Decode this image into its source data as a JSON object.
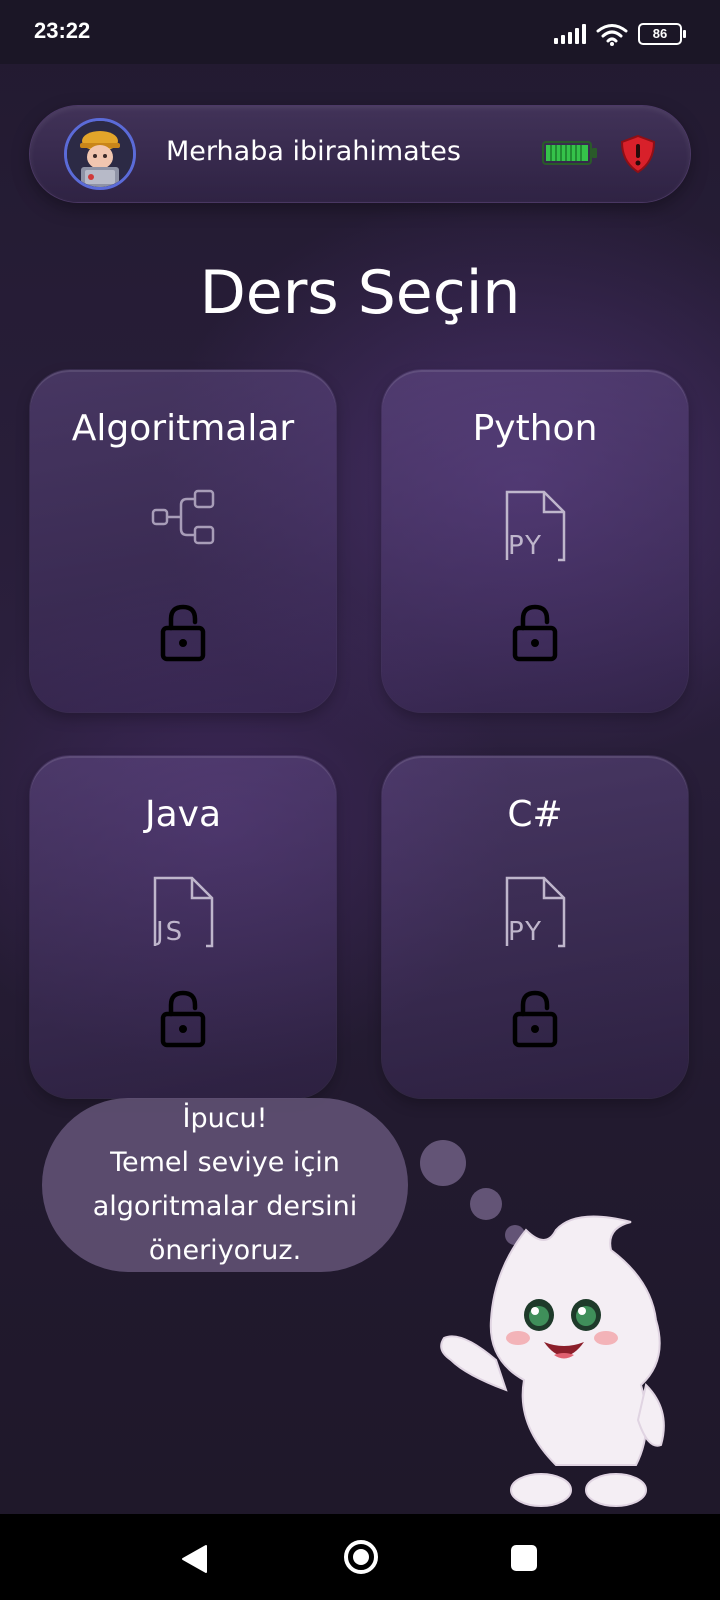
{
  "status_bar": {
    "time": "23:22",
    "battery_level": "86",
    "icons": [
      "signal-icon",
      "wifi-icon",
      "battery-icon"
    ]
  },
  "header": {
    "greeting": "Merhaba ibirahimates",
    "avatar_icon": "user-avatar",
    "energy_icon": "energy-battery-icon",
    "shield_icon": "shield-alert-icon",
    "colors": {
      "energy": "#35c24a",
      "shield": "#d8202a",
      "avatar_ring": "#5b6bd8"
    }
  },
  "page": {
    "title": "Ders Seçin"
  },
  "courses": [
    {
      "name": "Algoritmalar",
      "icon": "flowchart-icon",
      "locked": true
    },
    {
      "name": "Python",
      "icon": "py-file-icon",
      "locked": true
    },
    {
      "name": "Java",
      "icon": "js-file-icon",
      "locked": true
    },
    {
      "name": "C#",
      "icon": "py-file-icon",
      "locked": true
    }
  ],
  "tip": {
    "title": "İpucu!",
    "line1": "Temel seviye için",
    "line2": "algoritmalar dersini",
    "line3": "öneriyoruz."
  },
  "mascot": {
    "icon": "fluffy-mascot-icon"
  },
  "nav_bar": {
    "icons": [
      "back-icon",
      "home-icon",
      "recent-apps-icon"
    ]
  }
}
